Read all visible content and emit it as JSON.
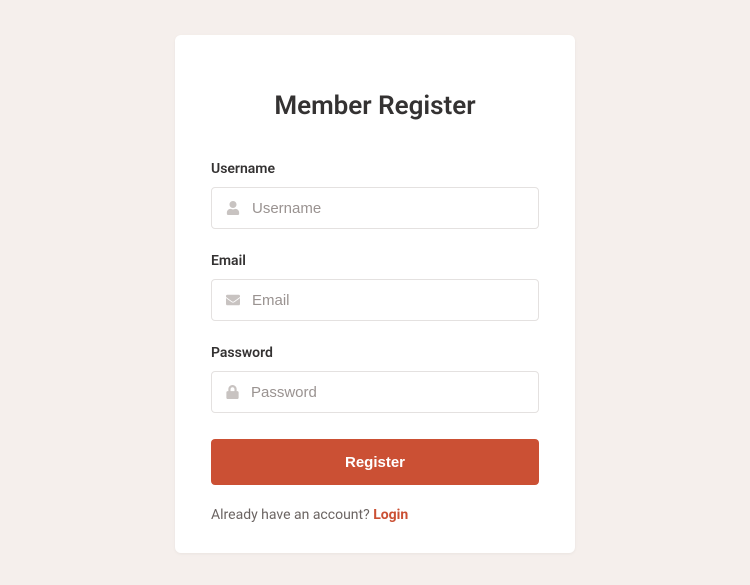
{
  "title": "Member Register",
  "fields": {
    "username": {
      "label": "Username",
      "placeholder": "Username",
      "value": ""
    },
    "email": {
      "label": "Email",
      "placeholder": "Email",
      "value": ""
    },
    "password": {
      "label": "Password",
      "placeholder": "Password",
      "value": ""
    }
  },
  "button": {
    "register": "Register"
  },
  "footer": {
    "text": "Already have an account? ",
    "link": "Login"
  }
}
